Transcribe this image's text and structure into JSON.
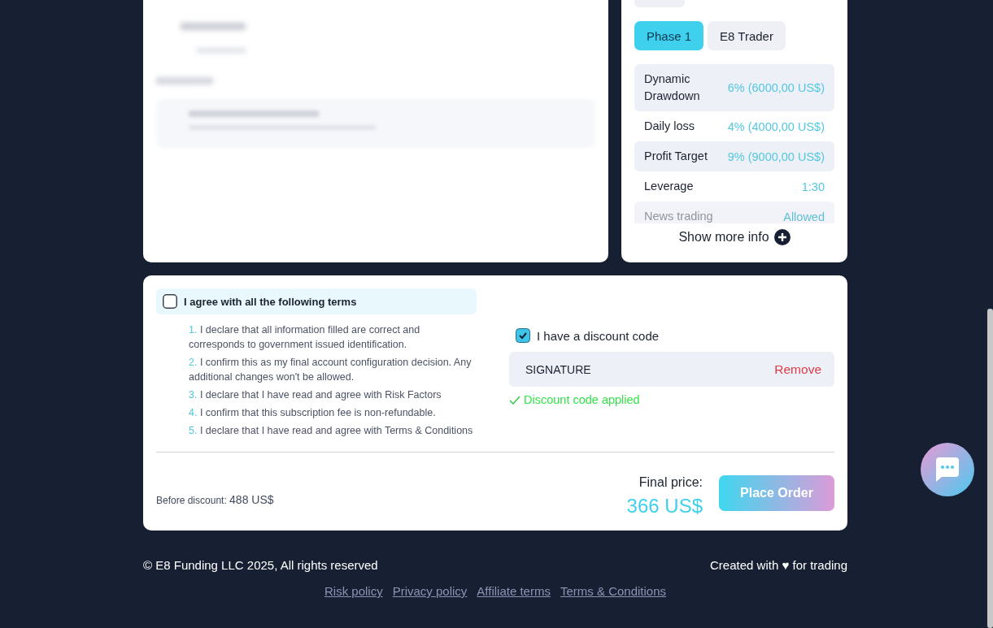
{
  "plan_tabs": [
    {
      "label": "Phase 1",
      "selected": true
    },
    {
      "label": "E8 Trader",
      "selected": false
    }
  ],
  "specs": [
    {
      "label": "Dynamic Drawdown",
      "value": "6% (6000,00 US$)"
    },
    {
      "label": "Daily loss",
      "value": "4% (4000,00 US$)"
    },
    {
      "label": "Profit Target",
      "value": "9% (9000,00 US$)"
    },
    {
      "label": "Leverage",
      "value": "1:30"
    },
    {
      "label": "News trading",
      "value": "Allowed"
    }
  ],
  "show_more": "Show more info",
  "terms": {
    "label": "I agree with all the following terms",
    "checked": false,
    "items": [
      {
        "number": "1.",
        "text": "I declare that all information filled are correct and corresponds to government issued identification."
      },
      {
        "number": "2.",
        "text": "I confirm this as my final account configuration decision. Any additional changes won't be allowed."
      },
      {
        "number": "3.",
        "text": "I declare that I have read and agree with Risk Factors"
      },
      {
        "number": "4.",
        "text": "I confirm that this subscription fee is non-refundable."
      },
      {
        "number": "5.",
        "text": "I declare that I have read and agree with Terms & Conditions"
      }
    ]
  },
  "discount": {
    "label": "I have a discount code",
    "checked": true,
    "code": "SIGNATURE",
    "remove": "Remove",
    "message": "Discount code applied"
  },
  "price": {
    "before_label": "Before discount:",
    "before_value": "488 US$",
    "final_label": "Final price:",
    "final_value": "366 US$"
  },
  "order_button": "Place Order",
  "footer": {
    "copyright": "© E8 Funding LLC 2025, All rights reserved",
    "tagline": "Created with ♥ for trading",
    "links": [
      "Risk policy",
      "Privacy policy",
      "Affiliate terms",
      "Terms & Conditions"
    ]
  }
}
